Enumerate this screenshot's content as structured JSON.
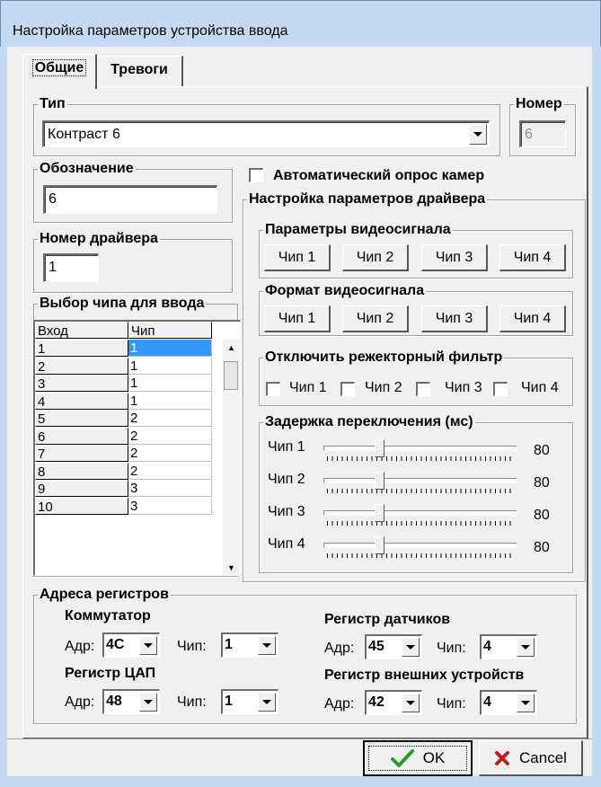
{
  "window": {
    "title": "Настройка параметров устройства ввода"
  },
  "tabs": [
    {
      "label": "Общие"
    },
    {
      "label": "Тревоги"
    }
  ],
  "type_group": {
    "title": "Тип",
    "value": "Контраст 6"
  },
  "number_group": {
    "title": "Номер",
    "value": "6"
  },
  "designation": {
    "title": "Обозначение",
    "value": "6"
  },
  "driver_number": {
    "title": "Номер драйвера",
    "value": "1"
  },
  "chip_select": {
    "title": "Выбор чипа для ввода",
    "columns": [
      "Вход",
      "Чип"
    ],
    "rows": [
      [
        "1",
        "1"
      ],
      [
        "2",
        "1"
      ],
      [
        "3",
        "1"
      ],
      [
        "4",
        "1"
      ],
      [
        "5",
        "2"
      ],
      [
        "6",
        "2"
      ],
      [
        "7",
        "2"
      ],
      [
        "8",
        "2"
      ],
      [
        "9",
        "3"
      ],
      [
        "10",
        "3"
      ]
    ]
  },
  "auto_poll": {
    "label": "Автоматический опрос камер",
    "checked": false
  },
  "driver_settings": {
    "title": "Настройка параметров драйвера",
    "video_params": {
      "title": "Параметры видеосигнала",
      "buttons": [
        "Чип 1",
        "Чип 2",
        "Чип 3",
        "Чип 4"
      ]
    },
    "video_format": {
      "title": "Формат видеосигнала",
      "buttons": [
        "Чип 1",
        "Чип 2",
        "Чип 3",
        "Чип 4"
      ]
    },
    "notch_filter": {
      "title": "Отключить режекторный фильтр",
      "items": [
        {
          "label": "Чип 1",
          "checked": false
        },
        {
          "label": "Чип 2",
          "checked": false
        },
        {
          "label": "Чип 3",
          "checked": false
        },
        {
          "label": "Чип 4",
          "checked": false
        }
      ]
    },
    "switch_delay": {
      "title": "Задержка переключения (мс)",
      "rows": [
        {
          "label": "Чип 1",
          "value": "80",
          "level": 0.24
        },
        {
          "label": "Чип 2",
          "value": "80",
          "level": 0.24
        },
        {
          "label": "Чип 3",
          "value": "80",
          "level": 0.24
        },
        {
          "label": "Чип 4",
          "value": "80",
          "level": 0.24
        }
      ]
    }
  },
  "registers": {
    "title": "Адреса регистров",
    "switch": {
      "title": "Коммутатор",
      "addr_label": "Адр:",
      "addr": "4C",
      "chip_label": "Чип:",
      "chip": "1"
    },
    "sensor": {
      "title": "Регистр датчиков",
      "addr_label": "Адр:",
      "addr": "45",
      "chip_label": "Чип:",
      "chip": "4"
    },
    "dac": {
      "title": "Регистр ЦАП",
      "addr_label": "Адр:",
      "addr": "48",
      "chip_label": "Чип:",
      "chip": "1"
    },
    "ext": {
      "title": "Регистр внешних устройств",
      "addr_label": "Адр:",
      "addr": "42",
      "chip_label": "Чип:",
      "chip": "4"
    }
  },
  "footer": {
    "ok": "OK",
    "cancel": "Cancel"
  },
  "colors": {
    "ok_check": "#2a9d2a",
    "cancel_x": "#c02020",
    "selection": "#3399ff"
  }
}
